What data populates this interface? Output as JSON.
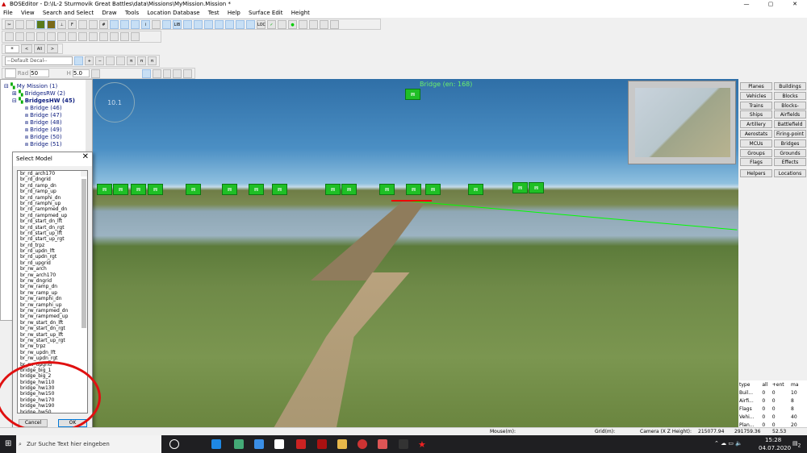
{
  "window": {
    "title": "BOSEditor - D:\\IL-2 Sturmovik Great Battles\\data\\Missions\\MyMission.Mission *",
    "minimize": "—",
    "maximize": "▢",
    "close": "✕"
  },
  "menu": [
    "File",
    "View",
    "Search and Select",
    "Draw",
    "Tools",
    "Location Database",
    "Test",
    "Help",
    "Surface Edit",
    "Height"
  ],
  "toolbar": {
    "decal_select": "--Default Decal--",
    "nav_star": "*",
    "nav_prev": "<",
    "nav_all": "All",
    "nav_next": ">",
    "rad_label": "Rad",
    "rad_value": "50",
    "h_label": "H",
    "h_value": "5.0",
    "loc_label": "LOC",
    "lib_label": "LIB"
  },
  "tree": {
    "root": "My Mission (1)",
    "group1": "BridgesRW (2)",
    "group2": "BridgesHW (45)",
    "items": [
      "Bridge (46)",
      "Bridge (47)",
      "Bridge (48)",
      "Bridge (49)",
      "Bridge (50)",
      "Bridge (51)"
    ]
  },
  "viewport": {
    "selected_label": "Bridge (en: 168)",
    "compass": "10.1"
  },
  "right_panel": {
    "buttons": [
      [
        "Planes",
        "Buildings"
      ],
      [
        "Vehicles",
        "Blocks"
      ],
      [
        "Trains",
        "Blocks-detail"
      ],
      [
        "Ships",
        "Airfields"
      ],
      [
        "Artillery",
        "Battlefield"
      ],
      [
        "Aerostats",
        "Firing-point"
      ],
      [
        "MCUs",
        "Bridges"
      ],
      [
        "Groups",
        "Grounds"
      ],
      [
        "Flags",
        "Effects"
      ],
      [
        "Helpers",
        "Locations"
      ]
    ]
  },
  "stats": {
    "headers": [
      "type",
      "all",
      "+ent",
      "ma"
    ],
    "rows": [
      [
        "Buil...",
        "0",
        "0",
        "10"
      ],
      [
        "Airfi...",
        "0",
        "0",
        "8"
      ],
      [
        "Flags",
        "0",
        "0",
        "8"
      ],
      [
        "Vehi...",
        "0",
        "0",
        "40"
      ],
      [
        "Plan...",
        "0",
        "0",
        "20"
      ]
    ]
  },
  "dialog": {
    "title": "Select Model",
    "close": "✕",
    "cancel": "Cancel",
    "ok": "OK",
    "selected": "bridge_pontoon_100",
    "items": [
      "br_rd_arch170",
      "br_rd_dngrid",
      "br_rd_ramp_dn",
      "br_rd_ramp_up",
      "br_rd_ramphi_dn",
      "br_rd_ramphi_up",
      "br_rd_rampmed_dn",
      "br_rd_rampmed_up",
      "br_rd_start_dn_lft",
      "br_rd_start_dn_rgt",
      "br_rd_start_up_lft",
      "br_rd_start_up_rgt",
      "br_rd_trpz",
      "br_rd_updn_lft",
      "br_rd_updn_rgt",
      "br_rd_upgrid",
      "br_rw_arch",
      "br_rw_arch170",
      "br_rw_dngrid",
      "br_rw_ramp_dn",
      "br_rw_ramp_up",
      "br_rw_ramphi_dn",
      "br_rw_ramphi_up",
      "br_rw_rampmed_dn",
      "br_rw_rampmed_up",
      "br_rw_start_dn_lft",
      "br_rw_start_dn_rgt",
      "br_rw_start_up_lft",
      "br_rw_start_up_rgt",
      "br_rw_trpz",
      "br_rw_updn_lft",
      "br_rw_updn_rgt",
      "br_rw_upgrid",
      "bridge_big_1",
      "bridge_big_2",
      "bridge_hw110",
      "bridge_hw130",
      "bridge_hw150",
      "bridge_hw170",
      "bridge_hw190",
      "bridge_hw50",
      "bridge_hw70",
      "bridge_hw90",
      "bridge_pontoon_100",
      "bridge_railroad_100"
    ]
  },
  "status": {
    "mouse_label": "Mouse(m):",
    "grid_label": "Grid(m):",
    "camera_label": "Camera (X Z Height):",
    "camera_x": "215077.94",
    "camera_z": "291759.36",
    "camera_h": "52.53"
  },
  "taskbar": {
    "search_placeholder": "Zur Suche Text hier eingeben",
    "time": "15:28",
    "date": "04.07.2020",
    "notifications": "2"
  },
  "colors": {
    "accent": "#0078d7",
    "annotation": "#e01010",
    "bridge_marker": "#1fbf25"
  }
}
